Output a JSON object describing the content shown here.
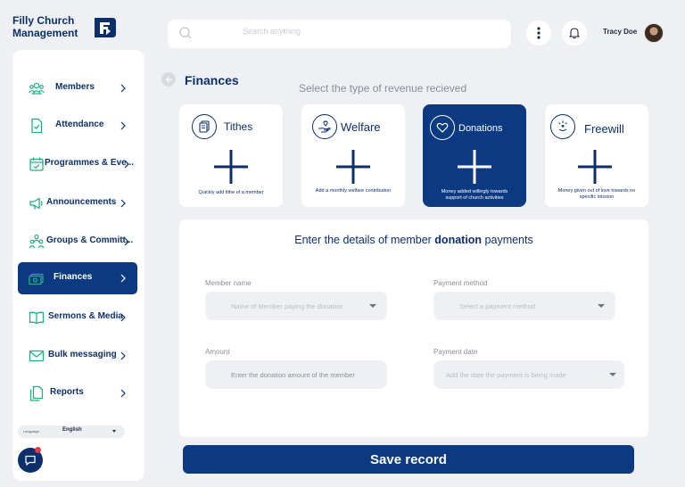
{
  "app": {
    "name_line1": "Filly Church",
    "name_line2": "Management"
  },
  "header": {
    "search_placeholder": "Search anything",
    "user_name": "Tracy Doe"
  },
  "sidebar": {
    "items": [
      {
        "label": "Members",
        "icon": "members-icon"
      },
      {
        "label": "Attendance",
        "icon": "attendance-icon"
      },
      {
        "label": "Programmes & Eve...",
        "icon": "calendar-icon"
      },
      {
        "label": "Announcements",
        "icon": "megaphone-icon"
      },
      {
        "label": "Groups & Committ...",
        "icon": "groups-icon"
      },
      {
        "label": "Finances",
        "icon": "money-icon",
        "active": true
      },
      {
        "label": "Sermons & Media",
        "icon": "book-icon"
      },
      {
        "label": "Bulk messaging",
        "icon": "mail-icon"
      },
      {
        "label": "Reports",
        "icon": "reports-icon"
      }
    ],
    "language_caption": "Language",
    "language_value": "English"
  },
  "main": {
    "title": "Finances",
    "subtitle": "Select the type of revenue recieved",
    "revenue_types": [
      {
        "title": "Tithes",
        "description": "Quickly add tithe of a member"
      },
      {
        "title": "Welfare",
        "description": "Add a monthly welfare contribution"
      },
      {
        "title": "Donations",
        "description": "Money added willingly towards support of church activities",
        "selected": true
      },
      {
        "title": "Freewill",
        "description": "Money given out of love towards no specific mission"
      }
    ],
    "form": {
      "heading_prefix": "Enter the details of member ",
      "heading_bold": "donation",
      "heading_suffix": " payments",
      "member_name_label": "Member name",
      "member_name_placeholder": "Name of Member paying the donation",
      "payment_method_label": "Payment method",
      "payment_method_placeholder": "Select a payment method",
      "amount_label": "Amount",
      "amount_placeholder": "Enter the donation amount of the member",
      "payment_date_label": "Payment date",
      "payment_date_placeholder": "Add the date the payment is being made"
    },
    "save_label": "Save record"
  },
  "colors": {
    "primary": "#0b3a82",
    "accent_green": "#22b07d",
    "background": "#eef0f3",
    "badge": "#e63946"
  }
}
